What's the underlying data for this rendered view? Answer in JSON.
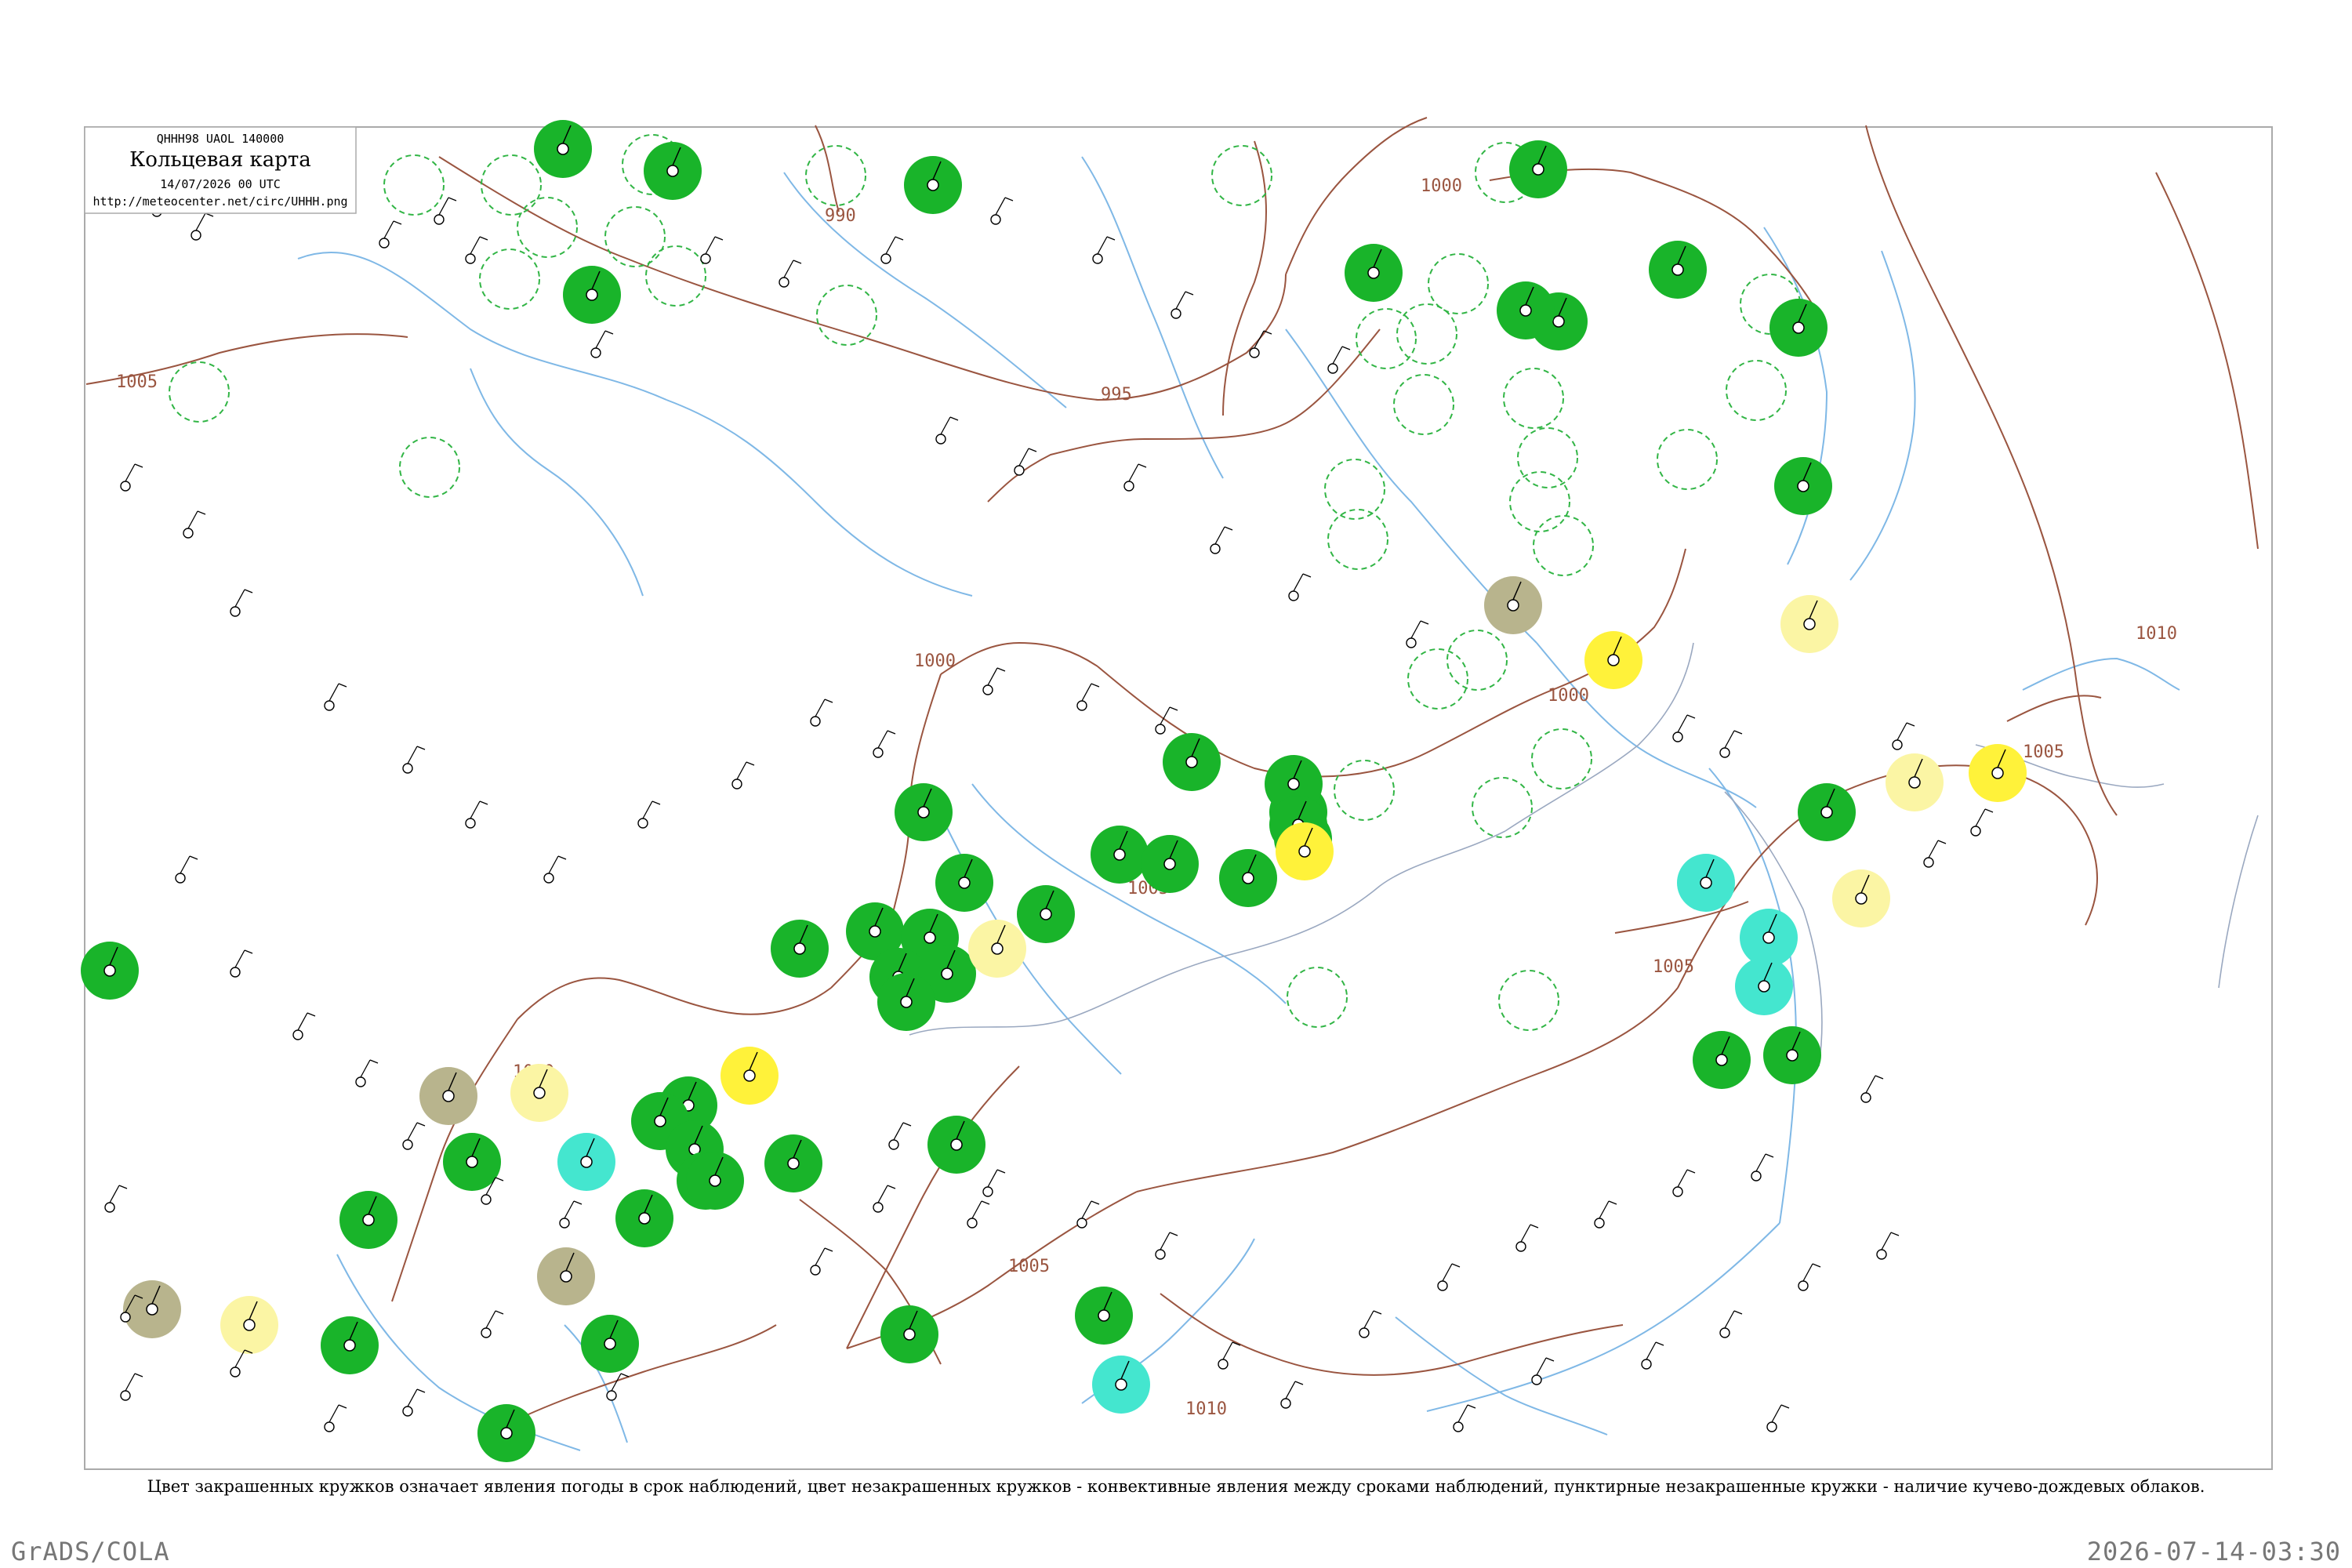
{
  "header": {
    "code_line": "QHHH98  UAOL  140000",
    "title": "Кольцевая карта",
    "date_line": "14/07/2026 00 UTC",
    "url": "http://meteocenter.net/circ/UHHH.png"
  },
  "isobar_labels": [
    "1005",
    "995",
    "990",
    "1000",
    "1000",
    "1000",
    "1005",
    "1005",
    "1000",
    "1010",
    "1005",
    "1005",
    "1010"
  ],
  "colors": {
    "isobar": "#9a5540",
    "river": "#7fb8e6",
    "border": "#9aa8c0",
    "green": "#19b42a",
    "yellow": "#fff23a",
    "pale_yellow": "#fbf5a4",
    "cyan": "#44e6cf",
    "olive": "#b8b48d",
    "dashed_ring": "#31b545"
  },
  "legend_note": "Цвет закрашенных кружков означает явления погоды в срок наблюдений, цвет незакрашенных кружков - конвективные явления между сроками наблюдений, пунктирные незакрашенные кружки - наличие кучево-дождевых облаков.",
  "footer": {
    "left": "GrADS/COLA",
    "right": "2026-07-14-03:30"
  }
}
